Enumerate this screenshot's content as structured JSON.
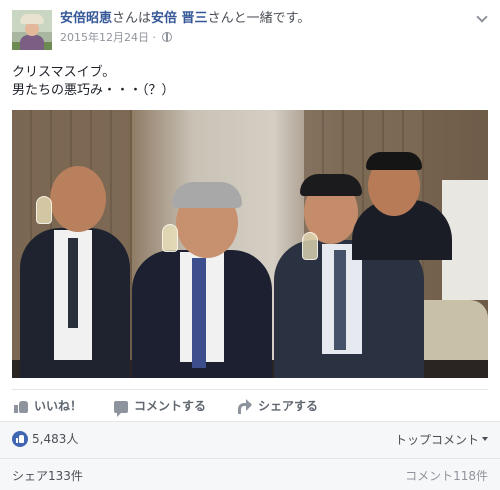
{
  "header": {
    "author": "安倍昭恵",
    "with_text_1": "さんは",
    "tagged": "安倍 晋三",
    "with_text_2": "さんと一緒です。",
    "date": "2015年12月24日",
    "privacy_icon": "globe-icon",
    "menu_icon": "chevron-down-icon"
  },
  "post": {
    "line1": "クリスマスイブ。",
    "line2": "男たちの悪巧み・・・（？）"
  },
  "actions": {
    "like": "いいね！",
    "comment": "コメントする",
    "share": "シェアする"
  },
  "stats": {
    "likes": "5,483人",
    "top_comments": "トップコメント",
    "shares": "シェア133件",
    "comments": "コメント118件"
  },
  "colors": {
    "link": "#365899",
    "like_blue": "#4267b2",
    "meta": "#90949c"
  }
}
